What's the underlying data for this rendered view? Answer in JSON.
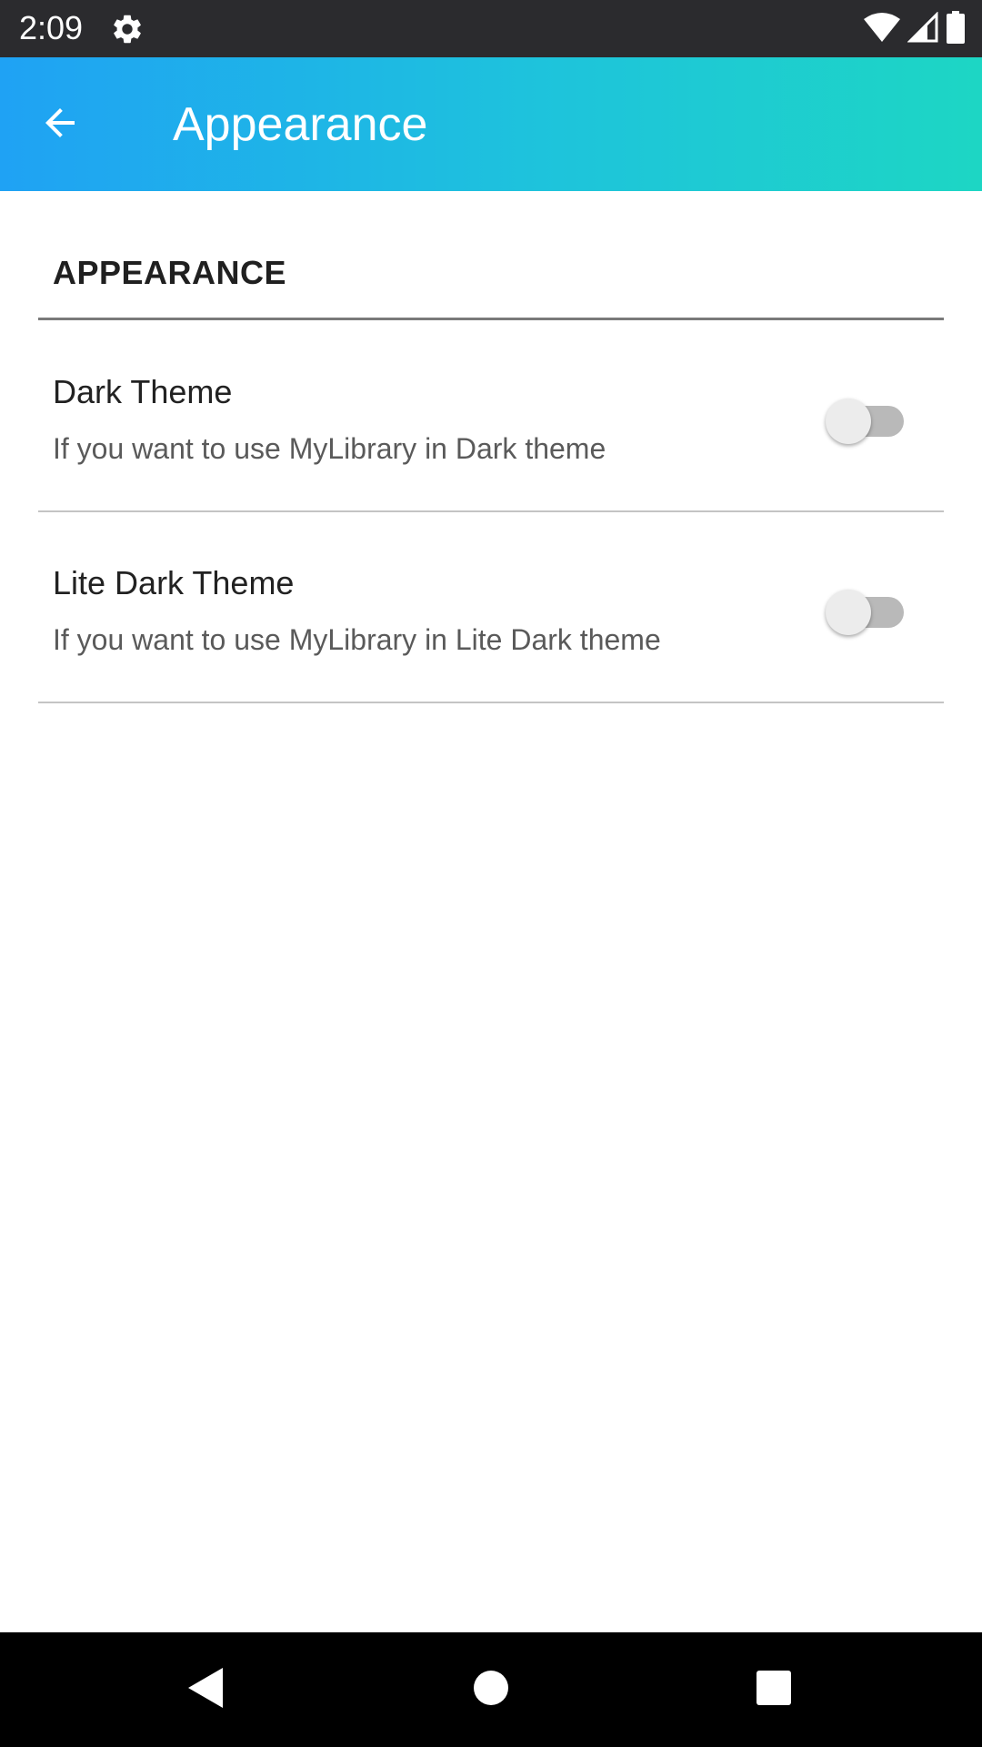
{
  "status_bar": {
    "time": "2:09",
    "icons": [
      "gear-icon",
      "wifi-icon",
      "signal-icon",
      "battery-icon"
    ]
  },
  "app_bar": {
    "title": "Appearance",
    "back_icon": "arrow-back-icon",
    "gradient_start": "#1fa2f4",
    "gradient_end": "#1dd6c4"
  },
  "settings": {
    "section_title": "APPEARANCE",
    "items": [
      {
        "title": "Dark Theme",
        "summary": "If you want to use MyLibrary in Dark theme",
        "enabled": false
      },
      {
        "title": "Lite Dark Theme",
        "summary": "If you want to use MyLibrary in Lite Dark theme",
        "enabled": false
      }
    ]
  },
  "nav_bar": {
    "icons": [
      "back-triangle-icon",
      "home-circle-icon",
      "recents-square-icon"
    ]
  }
}
